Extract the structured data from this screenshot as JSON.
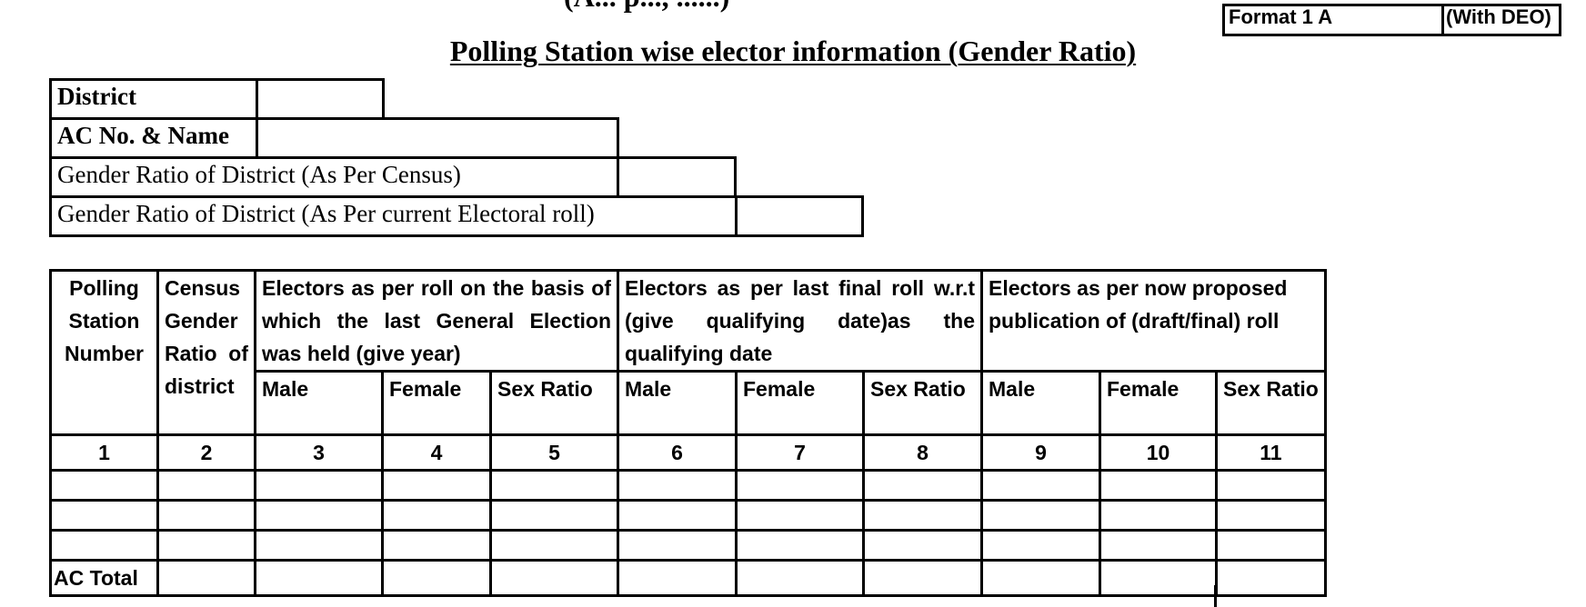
{
  "header": {
    "cut_text": "(A... p..., ......)",
    "format_label": "Format 1 A",
    "with_label": "(With DEO)"
  },
  "title": "Polling Station wise elector information (Gender Ratio)",
  "info_rows": [
    {
      "label": "District"
    },
    {
      "label": "AC No. & Name"
    },
    {
      "label": "Gender Ratio of District (As Per Census)"
    },
    {
      "label": "Gender Ratio of District (As Per current Electoral roll)"
    }
  ],
  "table": {
    "col1": [
      "Polling",
      "Station",
      "Number"
    ],
    "col2": [
      "Census",
      "Gender",
      "Ratio  of",
      "district"
    ],
    "group1": [
      "Electors as per roll on the basis of",
      "which the last General Election",
      "was held (give year)"
    ],
    "group2": [
      "Electors as per last final roll w.r.t",
      "(give    qualifying    date)as    the",
      "qualifying date"
    ],
    "group3": [
      "Electors as per now proposed",
      "publication of (draft/final) roll"
    ],
    "sub": [
      "Male",
      "Female",
      "Sex Ratio"
    ],
    "col_numbers": [
      "1",
      "2",
      "3",
      "4",
      "5",
      "6",
      "7",
      "8",
      "9",
      "10",
      "11"
    ],
    "total_label": "AC Total"
  }
}
